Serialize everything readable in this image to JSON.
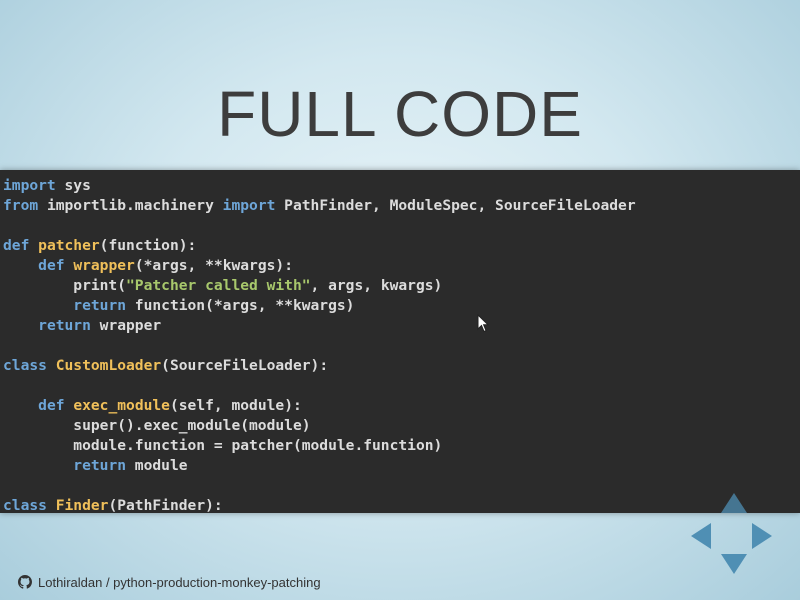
{
  "slide": {
    "title": "FULL CODE"
  },
  "code": {
    "lines": [
      "import sys",
      "from importlib.machinery import PathFinder, ModuleSpec, SourceFileLoader",
      "",
      "def patcher(function):",
      "    def wrapper(*args, **kwargs):",
      "        print(\"Patcher called with\", args, kwargs)",
      "        return function(*args, **kwargs)",
      "    return wrapper",
      "",
      "class CustomLoader(SourceFileLoader):",
      "",
      "    def exec_module(self, module):",
      "        super().exec_module(module)",
      "        module.function = patcher(module.function)",
      "        return module",
      "",
      "class Finder(PathFinder):"
    ]
  },
  "footer": {
    "icon": "github-icon",
    "repo_text": "Lothiraldan / python-production-monkey-patching"
  },
  "navigation": {
    "icons": [
      "nav-up-arrow-icon",
      "nav-left-arrow-icon",
      "nav-right-arrow-icon",
      "nav-down-arrow-icon"
    ]
  },
  "colors": {
    "code_bg": "#2b2b2b",
    "keyword": "#6ea6d8",
    "function_name": "#f0c05a",
    "string": "#a8c86c",
    "nav_arrow": "#4f8fb4"
  }
}
